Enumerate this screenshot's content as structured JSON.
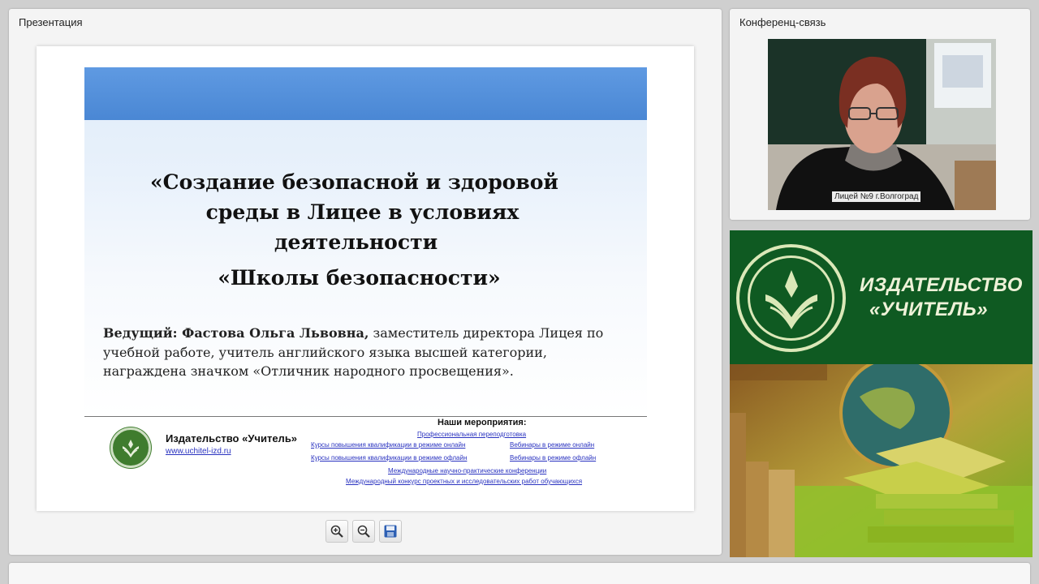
{
  "presentation": {
    "panel_title": "Презентация",
    "slide": {
      "title_lines": [
        "«Создание безопасной и здоровой",
        "среды в Лицее в условиях",
        "деятельности",
        "«Школы безопасности»"
      ],
      "presenter_label": "Ведущий: Фастова Ольга Львовна,",
      "presenter_text": " заместитель директора Лицея по учебной работе, учитель английского языка высшей категории, награждена значком «Отличник народного просвещения».",
      "footer": {
        "publisher_name": "Издательство «Учитель»",
        "publisher_url": "www.uchitel-izd.ru",
        "events_title": "Наши мероприятия:",
        "events": [
          "Профессиональная переподготовка",
          "Курсы повышения квалификации в режиме онлайн",
          "Вебинары в режиме онлайн",
          "Курсы повышения квалификации в режиме офлайн",
          "Вебинары в режиме офлайн",
          "Международные научно-практические конференции",
          "Международный конкурс проектных и исследовательских работ обучающихся"
        ]
      }
    },
    "toolbar": {
      "zoom_in_icon": "zoom-in-icon",
      "zoom_out_icon": "zoom-out-icon",
      "save_icon": "save-icon"
    }
  },
  "conference": {
    "panel_title": "Конференц-связь",
    "video_label": "Лицей №9 г.Волгоград"
  },
  "banner": {
    "line1": "ИЗДАТЕЛЬСТВО",
    "line2": "«УЧИТЕЛЬ»"
  },
  "colors": {
    "slide_band": "#4a87d4",
    "banner_green": "#0f5a22",
    "link_blue": "#2a33c0"
  }
}
